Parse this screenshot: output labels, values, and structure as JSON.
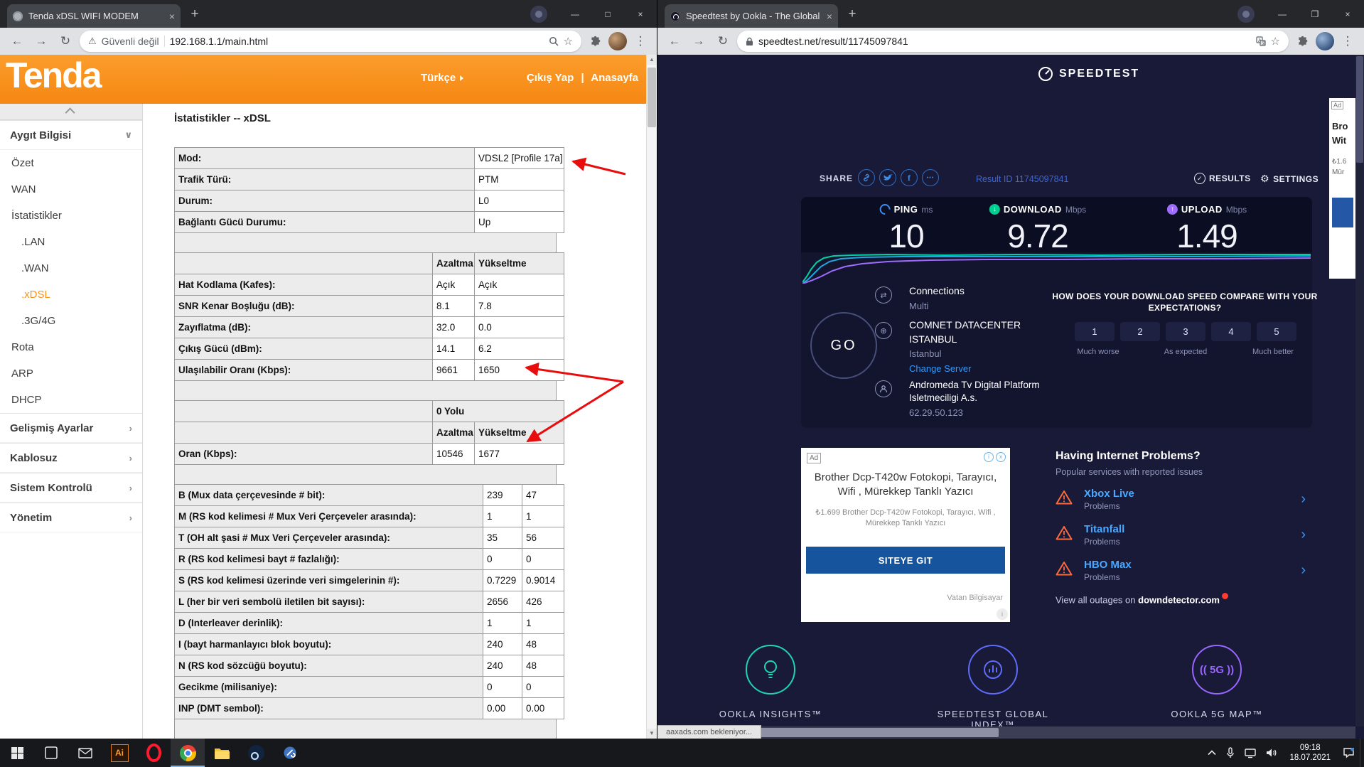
{
  "left_window": {
    "tab": {
      "title": "Tenda xDSL WIFI MODEM"
    },
    "address": {
      "security_text": "Güvenli değil",
      "url": "192.168.1.1/main.html"
    },
    "page": {
      "logo": "Tenda",
      "nav": {
        "language": "Türkçe",
        "logout": "Çıkış Yap",
        "home": "Anasayfa"
      },
      "sidebar": [
        {
          "label": "Aygıt Bilgisi",
          "style": "section",
          "chevron": "down"
        },
        {
          "label": "Özet",
          "style": "item"
        },
        {
          "label": "WAN",
          "style": "item"
        },
        {
          "label": "İstatistikler",
          "style": "item"
        },
        {
          "label": ".LAN",
          "style": "subitem"
        },
        {
          "label": ".WAN",
          "style": "subitem"
        },
        {
          "label": ".xDSL",
          "style": "subitem",
          "active": true
        },
        {
          "label": ".3G/4G",
          "style": "subitem"
        },
        {
          "label": "Rota",
          "style": "item"
        },
        {
          "label": "ARP",
          "style": "item"
        },
        {
          "label": "DHCP",
          "style": "item"
        },
        {
          "label": "Gelişmiş Ayarlar",
          "style": "section",
          "chevron": "right"
        },
        {
          "label": "Kablosuz",
          "style": "section",
          "chevron": "right"
        },
        {
          "label": "Sistem Kontrolü",
          "style": "section",
          "chevron": "right"
        },
        {
          "label": "Yönetim",
          "style": "section",
          "chevron": "right"
        }
      ],
      "title": "İstatistikler -- xDSL",
      "updown_header": {
        "down": "Azaltma",
        "up": "Yükseltme"
      },
      "info_table": [
        {
          "label": "Mod:",
          "value": "VDSL2 [Profile 17a]"
        },
        {
          "label": "Trafik Türü:",
          "value": "PTM"
        },
        {
          "label": "Durum:",
          "value": "L0"
        },
        {
          "label": "Bağlantı Gücü Durumu:",
          "value": "Up"
        }
      ],
      "stats_table": [
        {
          "label": "Hat Kodlama (Kafes):",
          "down": "Açık",
          "up": "Açık"
        },
        {
          "label": "SNR Kenar Boşluğu (dB):",
          "down": "8.1",
          "up": "7.8"
        },
        {
          "label": "Zayıflatma (dB):",
          "down": "32.0",
          "up": "0.0"
        },
        {
          "label": "Çıkış Gücü (dBm):",
          "down": "14.1",
          "up": "6.2"
        },
        {
          "label": "Ulaşılabilir Oranı (Kbps):",
          "down": "9661",
          "up": "1650"
        }
      ],
      "path_section": {
        "path_label": "0 Yolu",
        "rows": [
          {
            "label": "Oran (Kbps):",
            "down": "10546",
            "up": "1677"
          }
        ]
      },
      "detail_table": [
        {
          "label": "B (Mux data çerçevesinde # bit):",
          "down": "239",
          "up": "47"
        },
        {
          "label": "M (RS kod kelimesi # Mux Veri Çerçeveler arasında):",
          "down": "1",
          "up": "1"
        },
        {
          "label": "T (OH alt şasi # Mux Veri Çerçeveler arasında):",
          "down": "35",
          "up": "56"
        },
        {
          "label": "R (RS kod kelimesi bayt # fazlalığı):",
          "down": "0",
          "up": "0"
        },
        {
          "label": "S (RS kod kelimesi üzerinde veri simgelerinin #):",
          "down": "0.7229",
          "up": "0.9014"
        },
        {
          "label": "L (her bir veri sembolü iletilen bit sayısı):",
          "down": "2656",
          "up": "426"
        },
        {
          "label": "D (Interleaver derinlik):",
          "down": "1",
          "up": "1"
        },
        {
          "label": "I (bayt harmanlayıcı blok boyutu):",
          "down": "240",
          "up": "48"
        },
        {
          "label": "N (RS kod sözcüğü boyutu):",
          "down": "240",
          "up": "48"
        },
        {
          "label": "Gecikme (milisaniye):",
          "down": "0",
          "up": "0"
        },
        {
          "label": "INP (DMT sembol):",
          "down": "0.00",
          "up": "0.00"
        }
      ]
    }
  },
  "right_window": {
    "tab": {
      "title": "Speedtest by Ookla - The Global"
    },
    "address": {
      "url": "speedtest.net/result/11745097841"
    },
    "page": {
      "logo": "SPEEDTEST",
      "share_label": "SHARE",
      "share_icons": [
        "link",
        "twitter",
        "facebook",
        "more"
      ],
      "result_id_label": "Result ID",
      "result_id": "11745097841",
      "results_label": "RESULTS",
      "settings_label": "SETTINGS",
      "metrics": [
        {
          "name": "PING",
          "unit": "ms",
          "value": "10",
          "color": "#3a8ef0",
          "icon": "gauge"
        },
        {
          "name": "DOWNLOAD",
          "unit": "Mbps",
          "value": "9.72",
          "color": "#00cf92",
          "icon": "down"
        },
        {
          "name": "UPLOAD",
          "unit": "Mbps",
          "value": "1.49",
          "color": "#9e6cff",
          "icon": "up"
        }
      ],
      "go_label": "GO",
      "connections": {
        "title": "Connections",
        "value": "Multi"
      },
      "server": {
        "name": "COMNET DATACENTER ISTANBUL",
        "city": "Istanbul",
        "change_label": "Change Server"
      },
      "isp": {
        "name": "Andromeda Tv Digital Platform Isletmeciligi A.s.",
        "ip": "62.29.50.123"
      },
      "expectations": {
        "title": "HOW DOES YOUR DOWNLOAD SPEED COMPARE WITH YOUR EXPECTATIONS?",
        "ratings": [
          "1",
          "2",
          "3",
          "4",
          "5"
        ],
        "scale_labels": [
          "Much worse",
          "As expected",
          "Much better"
        ]
      },
      "ad": {
        "badge": "Ad",
        "headline": "Brother Dcp-T420w Fotokopi, Tarayıcı, Wifi , Mürekkep Tanklı Yazıcı",
        "body": "₺1.699 Brother Dcp-T420w Fotokopi, Tarayıcı, Wifi , Mürekkep Tanklı Yazıcı",
        "cta": "SITEYE GIT",
        "advertiser": "Vatan Bilgisayar"
      },
      "problems": {
        "title": "Having Internet Problems?",
        "subtitle": "Popular services with reported issues",
        "items": [
          {
            "name": "Xbox Live",
            "status": "Problems"
          },
          {
            "name": "Titanfall",
            "status": "Problems"
          },
          {
            "name": "HBO Max",
            "status": "Problems"
          }
        ],
        "outages_prefix": "View all outages on",
        "outages_link": "downdetector.com"
      },
      "footer": [
        {
          "label": "OOKLA INSIGHTS™",
          "color": "#1fd4b5",
          "glyph": "bulb"
        },
        {
          "label": "SPEEDTEST GLOBAL INDEX™",
          "color": "#5f6cfa",
          "glyph": "globe"
        },
        {
          "label": "OOKLA 5G MAP™",
          "color": "#9a66ff",
          "glyph": "5g"
        }
      ],
      "status_text": "aaxads.com bekleniyor...",
      "side_ad": {
        "badge": "Ad",
        "line1": "Bro",
        "line2": "Wit",
        "line3": "₺1.6",
        "line4": "Mür"
      }
    }
  },
  "taskbar": {
    "apps": [
      {
        "name": "start"
      },
      {
        "name": "task-view"
      },
      {
        "name": "mail"
      },
      {
        "name": "illustrator",
        "label": "Ai"
      },
      {
        "name": "opera"
      },
      {
        "name": "chrome",
        "active": true
      },
      {
        "name": "file-explorer"
      },
      {
        "name": "steam"
      },
      {
        "name": "utility"
      }
    ],
    "time": "09:18",
    "date": "18.07.2021"
  }
}
